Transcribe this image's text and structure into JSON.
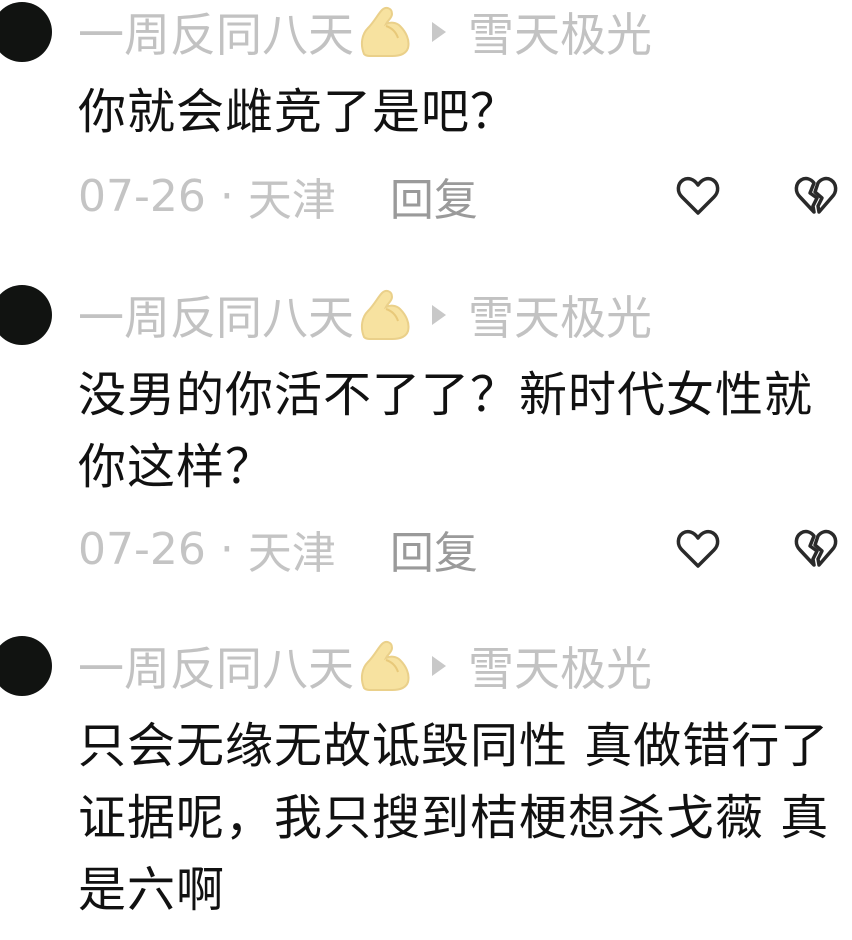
{
  "comments": [
    {
      "author": "一周反同八天",
      "reply_to": "雪天极光",
      "text": "你就会雌竞了是吧？",
      "date": "07-26",
      "location": "天津",
      "reply_label": "回复"
    },
    {
      "author": "一周反同八天",
      "reply_to": "雪天极光",
      "text": "没男的你活不了了？新时代女性就你这样？",
      "date": "07-26",
      "location": "天津",
      "reply_label": "回复"
    },
    {
      "author": "一周反同八天",
      "reply_to": "雪天极光",
      "text": "只会无缘无故诋毁同性 真做错行了证据呢，我只搜到桔梗想杀戈薇 真是六啊"
    }
  ],
  "separator": "·",
  "icons": {
    "author_badge": "flexed-biceps-icon",
    "reply_arrow": "play-arrow-icon",
    "like": "heart-icon",
    "dislike": "broken-heart-icon"
  },
  "colors": {
    "meta_text": "#c2c2c2",
    "body_text": "#111111",
    "reply_label": "#9a9a9a",
    "avatar": "#111311",
    "emoji": "#f6dc8a"
  }
}
